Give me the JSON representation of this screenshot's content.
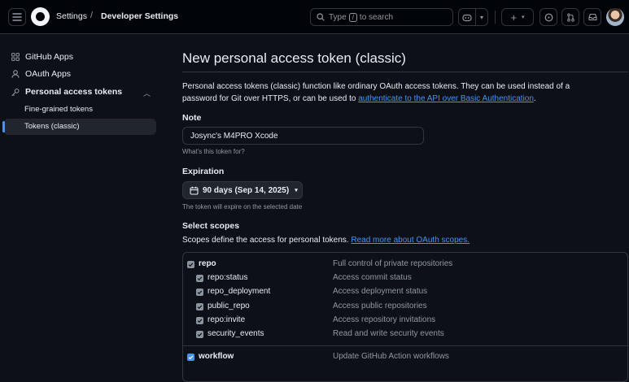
{
  "header": {
    "breadcrumb": [
      "Settings",
      "/",
      "Developer Settings"
    ],
    "search": {
      "prefix": "Type",
      "key": "/",
      "suffix": "to search"
    }
  },
  "sidebar": {
    "items": [
      {
        "label": "GitHub Apps",
        "icon": "apps-icon"
      },
      {
        "label": "OAuth Apps",
        "icon": "person-icon"
      },
      {
        "label": "Personal access tokens",
        "icon": "key-icon",
        "expanded": true
      }
    ],
    "subitems": [
      {
        "label": "Fine-grained tokens",
        "selected": false
      },
      {
        "label": "Tokens (classic)",
        "selected": true
      }
    ]
  },
  "main": {
    "title": "New personal access token (classic)",
    "description": "Personal access tokens (classic) function like ordinary OAuth access tokens. They can be used instead of a password for Git over HTTPS, or can be used to",
    "description_link": "authenticate to the API over Basic Authentication",
    "description_end": ".",
    "note": {
      "label": "Note",
      "value": "Josync's M4PRO Xcode",
      "hint": "What's this token for?"
    },
    "expiration": {
      "label": "Expiration",
      "value": "90 days (Sep 14, 2025)",
      "hint": "The token will expire on the selected date"
    },
    "scopes": {
      "label": "Select scopes",
      "description": "Scopes define the access for personal tokens.",
      "link": "Read more about OAuth scopes.",
      "items": [
        {
          "name": "repo",
          "desc": "Full control of private repositories",
          "checked": true
        },
        {
          "name": "repo:status",
          "desc": "Access commit status",
          "checked": true
        },
        {
          "name": "repo_deployment",
          "desc": "Access deployment status",
          "checked": true
        },
        {
          "name": "public_repo",
          "desc": "Access public repositories",
          "checked": true
        },
        {
          "name": "repo:invite",
          "desc": "Access repository invitations",
          "checked": true
        },
        {
          "name": "security_events",
          "desc": "Read and write security events",
          "checked": true
        },
        {
          "name": "workflow",
          "desc": "Update GitHub Action workflows",
          "checked": true
        }
      ]
    }
  },
  "colors": {
    "background": "#0d1117",
    "header_bg": "#010409",
    "border": "#30363d",
    "accent": "#4493f8",
    "muted": "#9198a1"
  }
}
